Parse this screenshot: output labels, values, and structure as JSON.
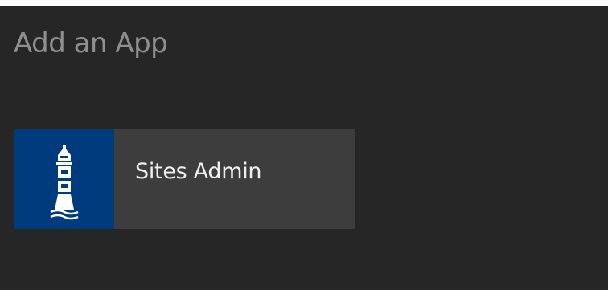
{
  "page": {
    "title": "Add an App"
  },
  "apps": [
    {
      "label": "Sites Admin",
      "icon": "lighthouse-icon",
      "tile_color": "#3d3d3d",
      "icon_background": "#003b7d"
    }
  ],
  "colors": {
    "background": "#262626",
    "title_text": "#8f8f8f",
    "tile_text": "#f0f0f0"
  }
}
